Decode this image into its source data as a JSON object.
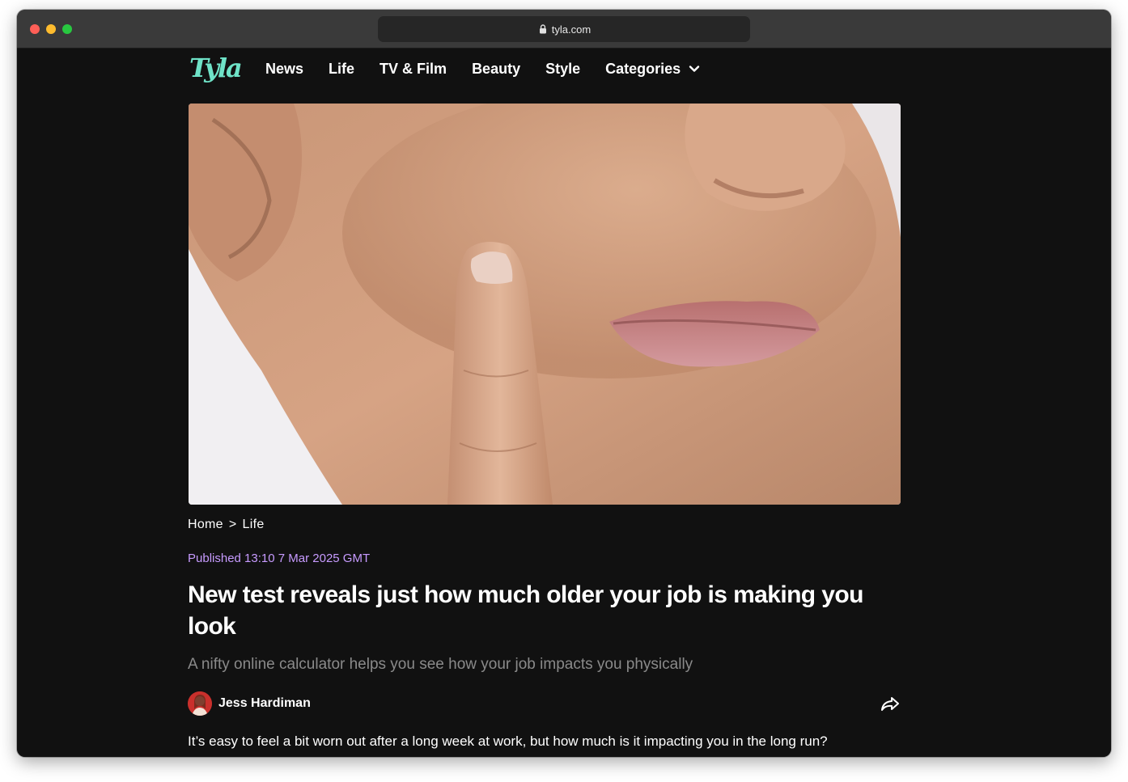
{
  "browser": {
    "url": "tyla.com"
  },
  "brand": {
    "logo_text": "Tyla",
    "accent": "#6fe3c8"
  },
  "nav": {
    "items": [
      {
        "label": "News"
      },
      {
        "label": "Life"
      },
      {
        "label": "TV & Film"
      },
      {
        "label": "Beauty"
      },
      {
        "label": "Style"
      },
      {
        "label": "Categories"
      }
    ]
  },
  "breadcrumb": {
    "home": "Home",
    "separator": ">",
    "current": "Life"
  },
  "article": {
    "published": "Published 13:10 7 Mar 2025 GMT",
    "headline": "New test reveals just how much older your job is making you look",
    "standfirst": "A nifty online calculator helps you see how your job impacts you physically",
    "author": "Jess Hardiman",
    "first_paragraph": "It’s easy to feel a bit worn out after a long week at work, but how much is it impacting you in the long run?"
  },
  "colors": {
    "page_bg": "#111111",
    "published": "#c79bff",
    "standfirst": "#8a8a8a"
  },
  "icons": {
    "lock": "lock-icon",
    "categories_dropdown": "chevron-down-icon",
    "share": "share-icon"
  }
}
